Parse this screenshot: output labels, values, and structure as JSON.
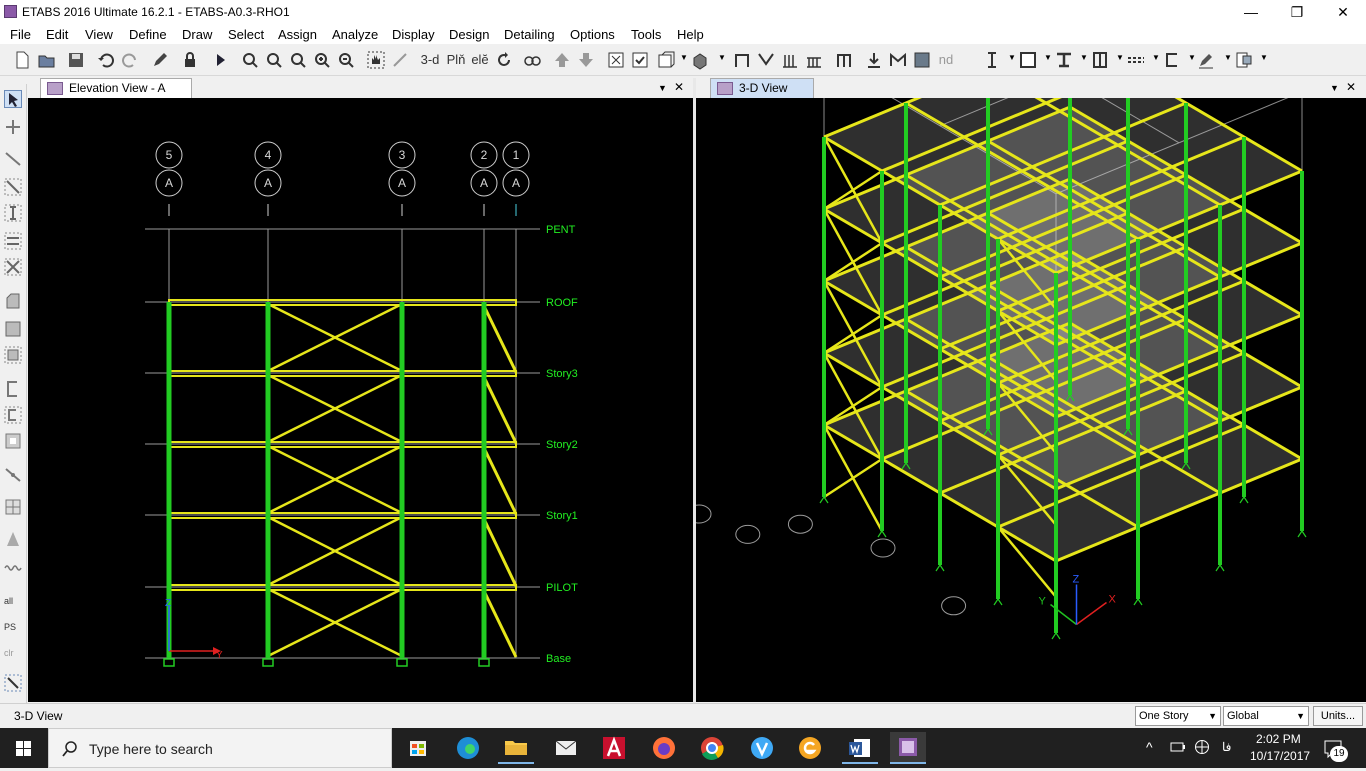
{
  "window": {
    "title": "ETABS 2016 Ultimate 16.2.1 - ETABS-A0.3-RHO1",
    "minimize": "—",
    "maximize": "❐",
    "close": "✕"
  },
  "menu": [
    "File",
    "Edit",
    "View",
    "Define",
    "Draw",
    "Select",
    "Assign",
    "Analyze",
    "Display",
    "Design",
    "Detailing",
    "Options",
    "Tools",
    "Help"
  ],
  "toolbar": {
    "view_3d": "3-d",
    "plan": "Plň",
    "elev": "elĕ",
    "nd": "nd"
  },
  "left_tools": {
    "all": "all",
    "ps": "PS",
    "clr": "clr"
  },
  "panels": {
    "left": {
      "tab": "Elevation View - A",
      "gridlines": [
        {
          "num": "5",
          "letter": "A"
        },
        {
          "num": "4",
          "letter": "A"
        },
        {
          "num": "3",
          "letter": "A"
        },
        {
          "num": "2",
          "letter": "A"
        },
        {
          "num": "1",
          "letter": "A"
        }
      ],
      "stories": [
        "PENT",
        "ROOF",
        "Story3",
        "Story2",
        "Story1",
        "PILOT",
        "Base"
      ],
      "axis_z": "Z",
      "axis_y": "Y"
    },
    "right": {
      "tab": "3-D View",
      "axis_x": "X",
      "axis_y": "Y",
      "axis_z": "Z"
    }
  },
  "status": {
    "text": "3-D View",
    "story_mode": "One Story",
    "coord_system": "Global",
    "units_button": "Units..."
  },
  "taskbar": {
    "search_placeholder": "Type here to search",
    "time": "2:02 PM",
    "date": "10/17/2017",
    "lang": "فا",
    "notifications": "19"
  },
  "colors": {
    "frame_yellow": "#e6e61a",
    "column_green": "#22cc22",
    "story_label": "#22ee22",
    "grid_gray": "#9a9a9a"
  }
}
